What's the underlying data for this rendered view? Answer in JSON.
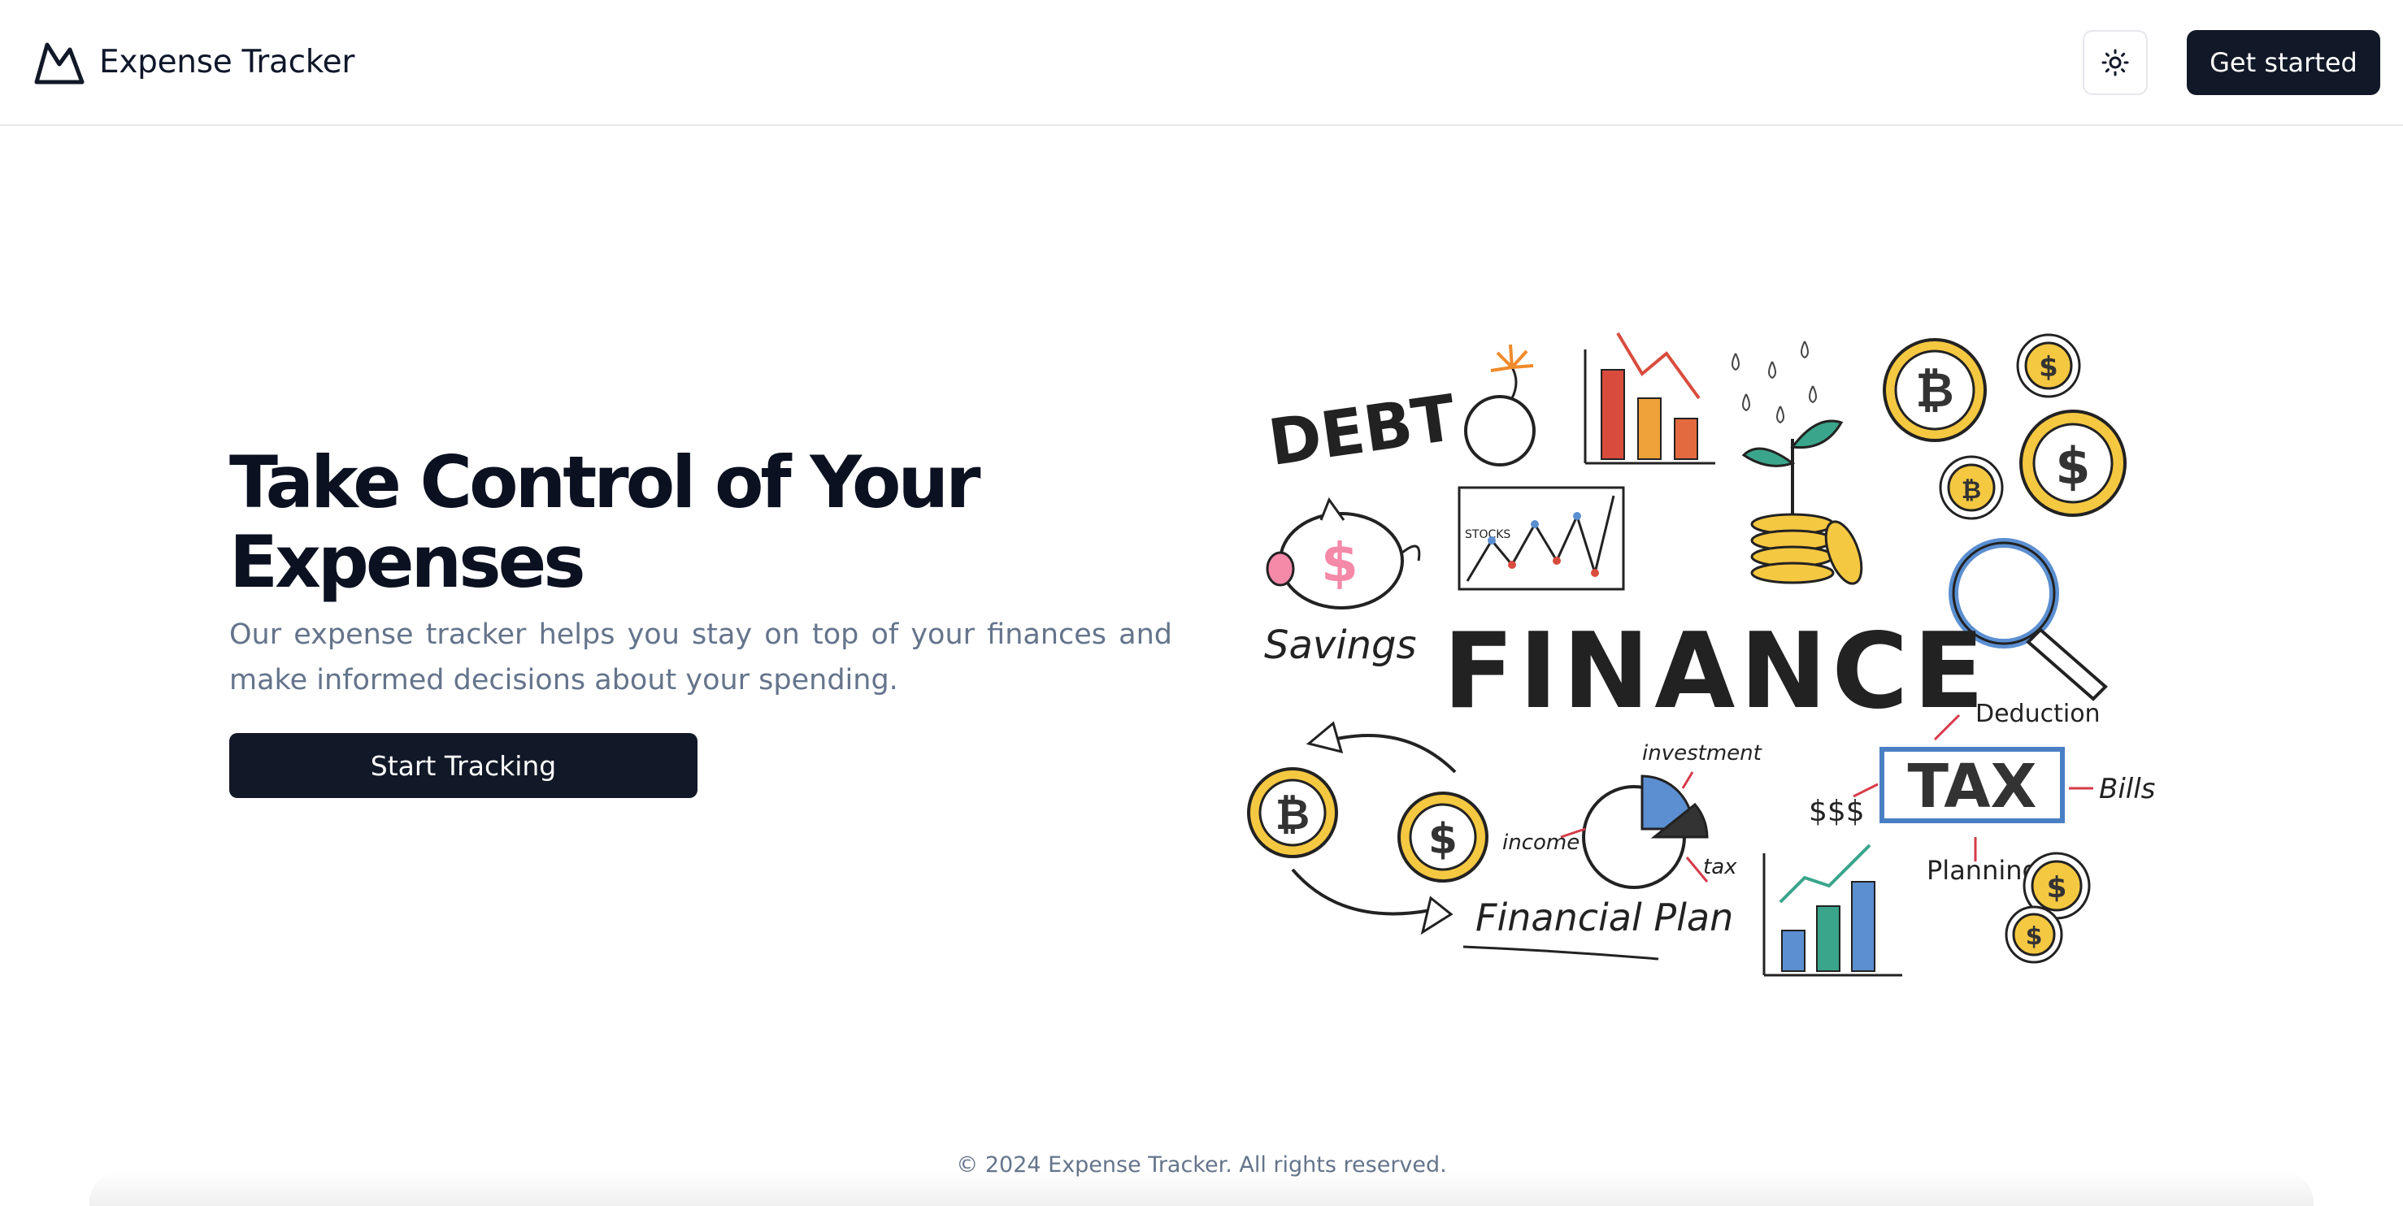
{
  "header": {
    "app_name": "Expense Tracker",
    "theme_toggle_icon": "sun-icon",
    "cta_label": "Get started"
  },
  "hero": {
    "title_line1": "Take Control of Your",
    "title_line2": "Expenses",
    "subtitle": "Our expense tracker helps you stay on top of your finances and make informed decisions about your spending.",
    "button_label": "Start Tracking"
  },
  "illustration": {
    "labels": {
      "debt": "DEBT",
      "savings": "Savings",
      "finance": "FINANCE",
      "stocks": "STOCKS",
      "investment": "investment",
      "income": "income",
      "tax_small": "tax",
      "financial_plan": "Financial Plan",
      "dollars": "$$$",
      "tax": "TAX",
      "deduction": "Deduction",
      "bills": "Bills",
      "planning": "Planning"
    },
    "colors": {
      "coin_gold": "#f5c842",
      "bar_red": "#d94c3d",
      "bar_orange": "#f0a23a",
      "bar_blue": "#5b8fd1",
      "bar_teal": "#3aa58a",
      "arrow_red": "#d63a4a",
      "tax_frame": "#4a7fc4",
      "magnifier": "#5b8fd1",
      "piggy_pink": "#f48aa8"
    }
  },
  "footer": {
    "copyright": "© 2024 Expense Tracker. All rights reserved."
  },
  "colors": {
    "primary_button": "#111827",
    "muted_text": "#64748b",
    "border": "#e5e7eb"
  }
}
